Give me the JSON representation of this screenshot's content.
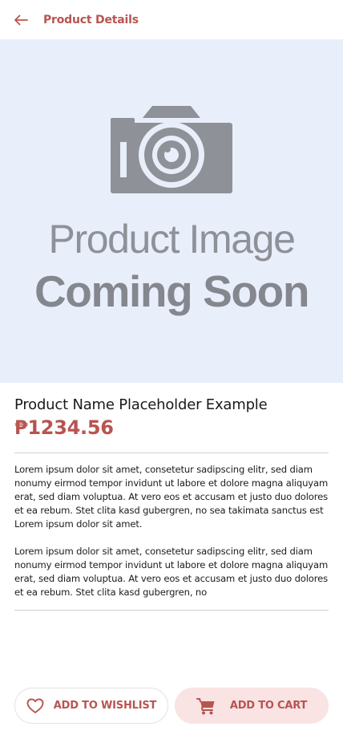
{
  "theme": {
    "accent": "#b85450",
    "accent_light": "#f9e3e3",
    "hero_bg": "#e9eefb",
    "placeholder_gray": "#8f9198"
  },
  "header": {
    "back_icon": "arrow-left-icon",
    "title": "Product Details"
  },
  "hero": {
    "camera_icon": "camera-icon",
    "line1": "Product Image",
    "line2": "Coming Soon"
  },
  "product": {
    "name": "Product Name Placeholder Example",
    "price": "₱1234.56",
    "description": [
      "Lorem ipsum dolor sit amet, consetetur sadipscing elitr, sed diam nonumy eirmod tempor invidunt ut labore et dolore magna aliquyam erat, sed diam voluptua. At vero eos et accusam et justo duo dolores et ea rebum. Stet clita kasd gubergren, no sea takimata sanctus est Lorem ipsum dolor sit amet.",
      "Lorem ipsum dolor sit amet, consetetur sadipscing elitr, sed diam nonumy eirmod tempor invidunt ut labore et dolore magna aliquyam erat, sed diam voluptua. At vero eos et accusam et justo duo dolores et ea rebum. Stet clita kasd gubergren, no"
    ]
  },
  "actions": {
    "wishlist_icon": "heart-icon",
    "wishlist_label": "ADD TO WISHLIST",
    "cart_icon": "cart-icon",
    "cart_label": "ADD TO CART"
  }
}
